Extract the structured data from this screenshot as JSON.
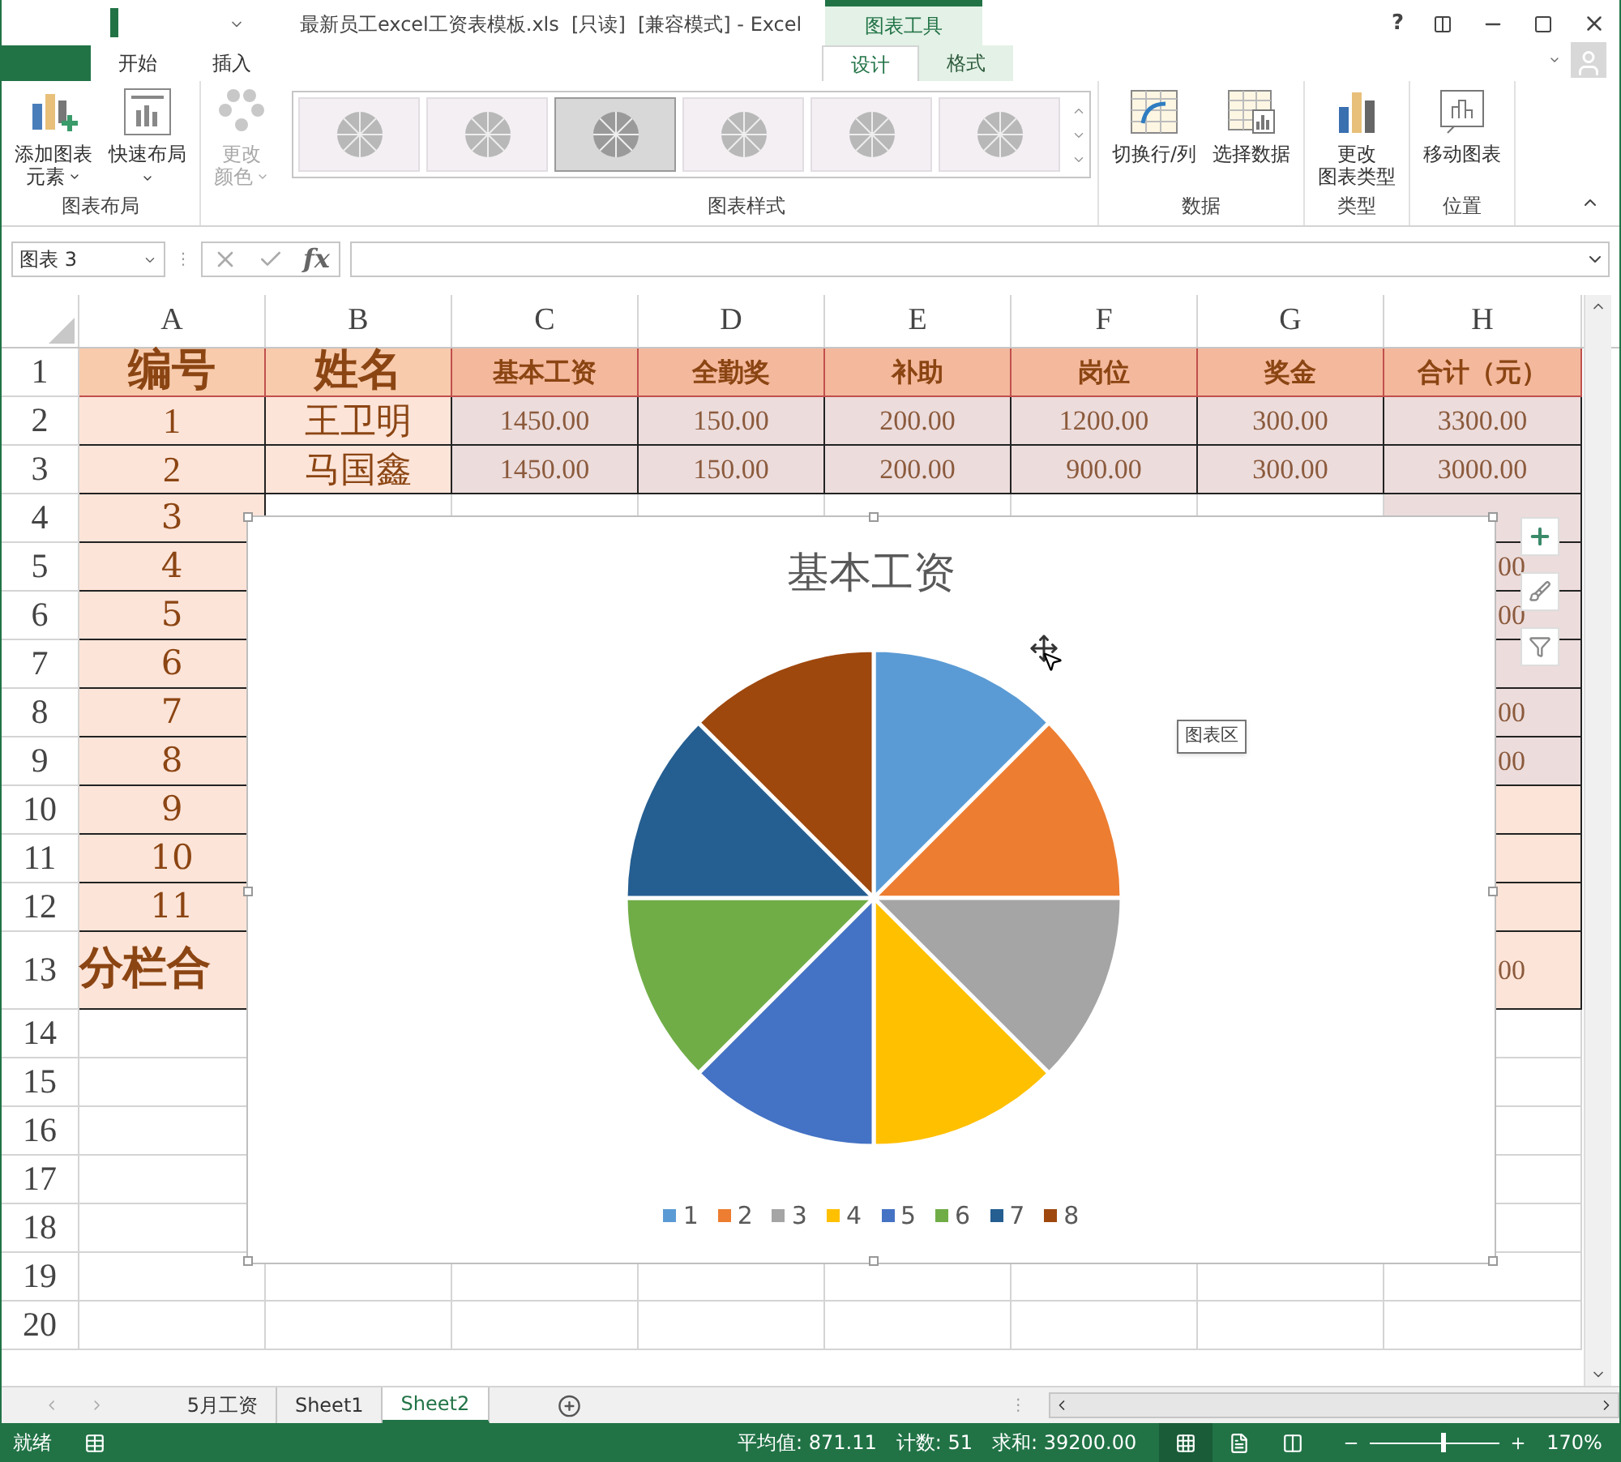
{
  "window": {
    "title": "最新员工excel工资表模板.xls  [只读]  [兼容模式] - Excel",
    "contextual_group": "图表工具",
    "help": "?"
  },
  "tabs": [
    {
      "label": "开始",
      "selected": false,
      "contextual": false
    },
    {
      "label": "插入",
      "selected": false,
      "contextual": false
    },
    {
      "label": "设计",
      "selected": true,
      "contextual": true
    },
    {
      "label": "格式",
      "selected": false,
      "contextual": true
    }
  ],
  "ribbon": {
    "groups": [
      {
        "label": "图表布局",
        "kind": "buttons",
        "buttons": [
          {
            "lines": [
              "添加图表",
              "元素"
            ],
            "dropdown": true,
            "disabled": false
          },
          {
            "lines": [
              "快速布局"
            ],
            "dropdown": true,
            "disabled": false
          }
        ]
      },
      {
        "kind": "gallery",
        "buttons": [
          {
            "lines": [
              "更改",
              "颜色"
            ],
            "dropdown": true,
            "disabled": true
          }
        ],
        "styles": [
          {
            "selected": false
          },
          {
            "selected": false
          },
          {
            "selected": true
          },
          {
            "selected": false
          },
          {
            "selected": false
          },
          {
            "selected": false
          }
        ],
        "caption": "图表样式"
      },
      {
        "label": "数据",
        "kind": "buttons",
        "buttons": [
          {
            "lines": [
              "切换行/列"
            ],
            "dropdown": false,
            "disabled": false
          },
          {
            "lines": [
              "选择数据"
            ],
            "dropdown": false,
            "disabled": false
          }
        ]
      },
      {
        "label": "类型",
        "kind": "buttons",
        "buttons": [
          {
            "lines": [
              "更改",
              "图表类型"
            ],
            "dropdown": false,
            "disabled": false
          }
        ]
      },
      {
        "label": "位置",
        "kind": "buttons",
        "buttons": [
          {
            "lines": [
              "移动图表"
            ],
            "dropdown": false,
            "disabled": false
          }
        ]
      }
    ]
  },
  "formula_bar": {
    "name_box": "图表 3",
    "separator": "⋮",
    "fx": "fx"
  },
  "columns": [
    "A",
    "B",
    "C",
    "D",
    "E",
    "F",
    "G",
    "H"
  ],
  "rows": [
    {
      "number": "1",
      "kind": "header",
      "cells": [
        "编号",
        "姓名",
        "基本工资",
        "全勤奖",
        "补助",
        "岗位",
        "奖金",
        "合计（元）"
      ]
    },
    {
      "number": "2",
      "kind": "data",
      "cells": [
        "1",
        "王卫明",
        "1450.00",
        "150.00",
        "200.00",
        "1200.00",
        "300.00",
        "3300.00"
      ]
    },
    {
      "number": "3",
      "kind": "data",
      "cells": [
        "2",
        "马国鑫",
        "1450.00",
        "150.00",
        "200.00",
        "900.00",
        "300.00",
        "3000.00"
      ]
    },
    {
      "number": "4",
      "kind": "covered",
      "a": "3"
    },
    {
      "number": "5",
      "kind": "covered",
      "a": "4",
      "h": "00"
    },
    {
      "number": "6",
      "kind": "covered",
      "a": "5",
      "h": "00"
    },
    {
      "number": "7",
      "kind": "covered",
      "a": "6"
    },
    {
      "number": "8",
      "kind": "covered",
      "a": "7",
      "h": "00"
    },
    {
      "number": "9",
      "kind": "covered",
      "a": "8",
      "h": "00"
    },
    {
      "number": "10",
      "kind": "covered_plain",
      "a": "9"
    },
    {
      "number": "11",
      "kind": "covered_plain",
      "a": "10"
    },
    {
      "number": "12",
      "kind": "covered_plain",
      "a": "11"
    },
    {
      "number": "13",
      "kind": "total",
      "a": "分栏合",
      "h": "00"
    },
    {
      "number": "14",
      "kind": "blank"
    },
    {
      "number": "15",
      "kind": "blank"
    },
    {
      "number": "16",
      "kind": "blank"
    },
    {
      "number": "17",
      "kind": "blank"
    },
    {
      "number": "18",
      "kind": "blank"
    },
    {
      "number": "19",
      "kind": "blank"
    },
    {
      "number": "20",
      "kind": "blank"
    }
  ],
  "chart": {
    "tooltip": "图表区",
    "chart_data": {
      "type": "pie",
      "title": "基本工资",
      "categories": [
        "1",
        "2",
        "3",
        "4",
        "5",
        "6",
        "7",
        "8"
      ],
      "values": [
        12.5,
        12.5,
        12.5,
        12.5,
        12.5,
        12.5,
        12.5,
        12.5
      ],
      "colors": [
        "#5b9bd5",
        "#ed7d31",
        "#a5a5a5",
        "#ffc000",
        "#4472c4",
        "#70ad47",
        "#255e91",
        "#9e480e"
      ],
      "legend": true
    }
  },
  "sheets": [
    {
      "label": "5月工资",
      "selected": false
    },
    {
      "label": "Sheet1",
      "selected": false
    },
    {
      "label": "Sheet2",
      "selected": true
    }
  ],
  "sheet_bar_separator": "⋮",
  "status_bar": {
    "ready": "就绪",
    "average": "平均值: 871.11",
    "count": "计数: 51",
    "sum": "求和: 39200.00",
    "views": [
      {
        "selected": true
      },
      {
        "selected": false
      },
      {
        "selected": false
      }
    ],
    "zoom_slider": {
      "level": 0.55
    },
    "zoom": "170%"
  }
}
